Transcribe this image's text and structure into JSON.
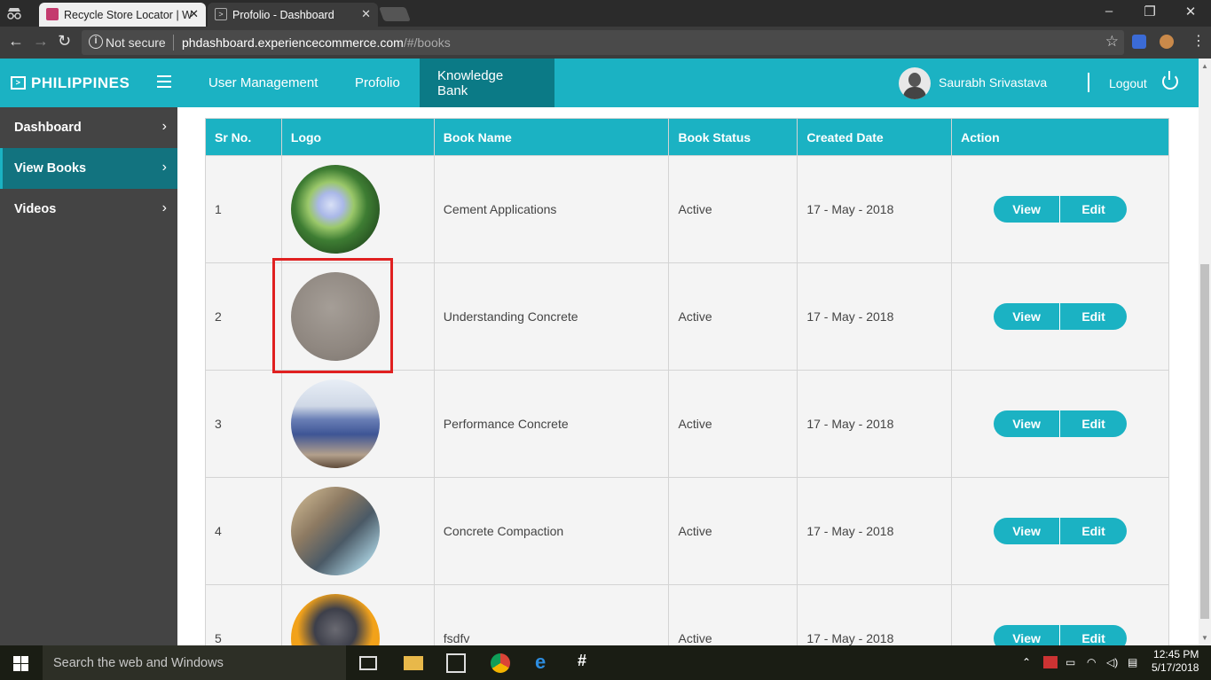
{
  "browser": {
    "tabs": [
      {
        "title": "Recycle Store Locator | W"
      },
      {
        "title": "Profolio - Dashboard"
      }
    ],
    "security_label": "Not secure",
    "url_host": "phdashboard.experiencecommerce.com",
    "url_path": "/#/books"
  },
  "app": {
    "brand": "PHILIPPINES",
    "nav": [
      {
        "label": "User Management"
      },
      {
        "label": "Profolio"
      },
      {
        "label": "Knowledge Bank"
      }
    ],
    "user_name": "Saurabh Srivastava",
    "logout_label": "Logout"
  },
  "sidebar": {
    "items": [
      {
        "label": "Dashboard"
      },
      {
        "label": "View Books"
      },
      {
        "label": "Videos"
      }
    ]
  },
  "table": {
    "columns": [
      "Sr No.",
      "Logo",
      "Book Name",
      "Book Status",
      "Created Date",
      "Action"
    ],
    "rows": [
      {
        "sr": "1",
        "name": "Cement Applications",
        "status": "Active",
        "date": "17 - May - 2018"
      },
      {
        "sr": "2",
        "name": "Understanding Concrete",
        "status": "Active",
        "date": "17 - May - 2018"
      },
      {
        "sr": "3",
        "name": "Performance Concrete",
        "status": "Active",
        "date": "17 - May - 2018"
      },
      {
        "sr": "4",
        "name": "Concrete Compaction",
        "status": "Active",
        "date": "17 - May - 2018"
      },
      {
        "sr": "5",
        "name": "fsdfv",
        "status": "Active",
        "date": "17 - May - 2018"
      }
    ],
    "view_label": "View",
    "edit_label": "Edit"
  },
  "taskbar": {
    "search_placeholder": "Search the web and Windows",
    "time": "12:45 PM",
    "date": "5/17/2018"
  },
  "colors": {
    "accent": "#1bb2c3",
    "accent_dark": "#0b7a86",
    "sidebar_bg": "#444444",
    "highlight": "#e02020"
  }
}
